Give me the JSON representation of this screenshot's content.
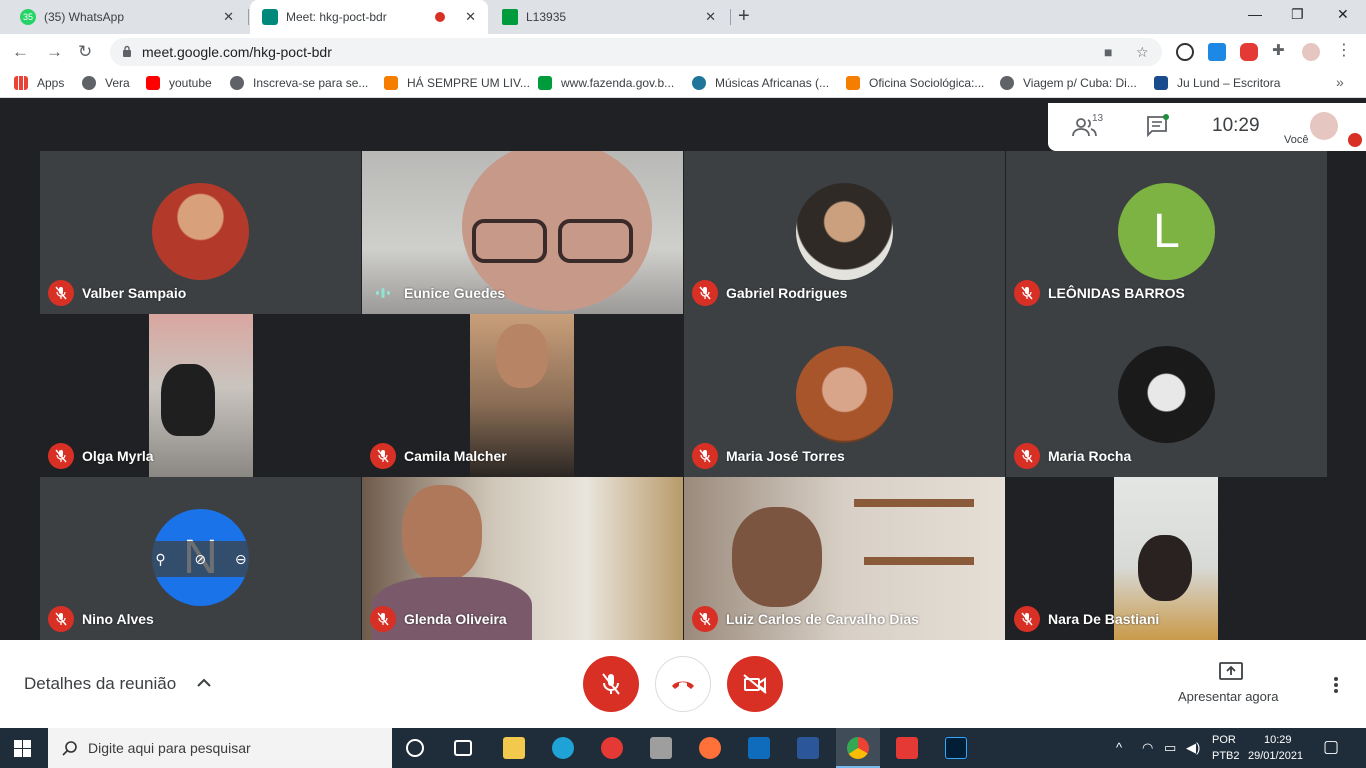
{
  "browser": {
    "tabs": [
      {
        "title": "(35) WhatsApp",
        "badge": "35",
        "icon": "whatsapp-icon"
      },
      {
        "title": "Meet: hkg-poct-bdr",
        "icon": "meet-icon",
        "active": true
      },
      {
        "title": "L13935",
        "icon": "brazil-flag-icon"
      }
    ],
    "url": "meet.google.com/hkg-poct-bdr",
    "bookmarks": [
      {
        "label": "Apps",
        "icon": "apps-grid-icon",
        "color": "#ea4335"
      },
      {
        "label": "Vera",
        "icon": "globe-icon",
        "color": "#5f6368"
      },
      {
        "label": "youtube",
        "icon": "youtube-icon",
        "color": "#ff0000"
      },
      {
        "label": "Inscreva-se para se...",
        "icon": "globe-icon",
        "color": "#5f6368"
      },
      {
        "label": "HÁ SEMPRE UM LIV...",
        "icon": "blogger-icon",
        "color": "#f57d00"
      },
      {
        "label": "www.fazenda.gov.b...",
        "icon": "brazil-flag-icon",
        "color": "#009c3b"
      },
      {
        "label": "Músicas Africanas (...",
        "icon": "wordpress-icon",
        "color": "#21759b"
      },
      {
        "label": "Oficina Sociológica:...",
        "icon": "blogger-icon",
        "color": "#f57d00"
      },
      {
        "label": "Viagem p/ Cuba: Di...",
        "icon": "globe-icon",
        "color": "#5f6368"
      },
      {
        "label": "Ju Lund – Escritora",
        "icon": "d-icon",
        "color": "#1a4b8c"
      }
    ]
  },
  "meet": {
    "participant_count": "13",
    "time": "10:29",
    "self_label": "Você",
    "participants": [
      {
        "name": "Valber Sampaio",
        "muted": true,
        "type": "avatar"
      },
      {
        "name": "Eunice Guedes",
        "muted": false,
        "type": "video",
        "speaking": true
      },
      {
        "name": "Gabriel Rodrigues",
        "muted": true,
        "type": "avatar"
      },
      {
        "name": "LEÔNIDAS BARROS",
        "muted": true,
        "type": "letter",
        "letter": "L",
        "color": "#7cb342"
      },
      {
        "name": "Olga Myrla",
        "muted": true,
        "type": "video"
      },
      {
        "name": "Camila Malcher",
        "muted": true,
        "type": "video"
      },
      {
        "name": "Maria José Torres",
        "muted": true,
        "type": "avatar"
      },
      {
        "name": "Maria Rocha",
        "muted": true,
        "type": "avatar"
      },
      {
        "name": "Nino Alves",
        "muted": true,
        "type": "letter",
        "letter": "N",
        "color": "#1a73e8"
      },
      {
        "name": "Glenda Oliveira",
        "muted": true,
        "type": "video"
      },
      {
        "name": "Luiz Carlos de Carvalho Dias",
        "muted": true,
        "type": "video"
      },
      {
        "name": "Nara De Bastiani",
        "muted": true,
        "type": "video"
      }
    ],
    "details_label": "Detalhes da reunião",
    "present_label": "Apresentar agora",
    "accent_red": "#d93025"
  },
  "taskbar": {
    "search_placeholder": "Digite aqui para pesquisar",
    "lang": "POR",
    "layout": "PTB2",
    "time": "10:29",
    "date": "29/01/2021"
  }
}
